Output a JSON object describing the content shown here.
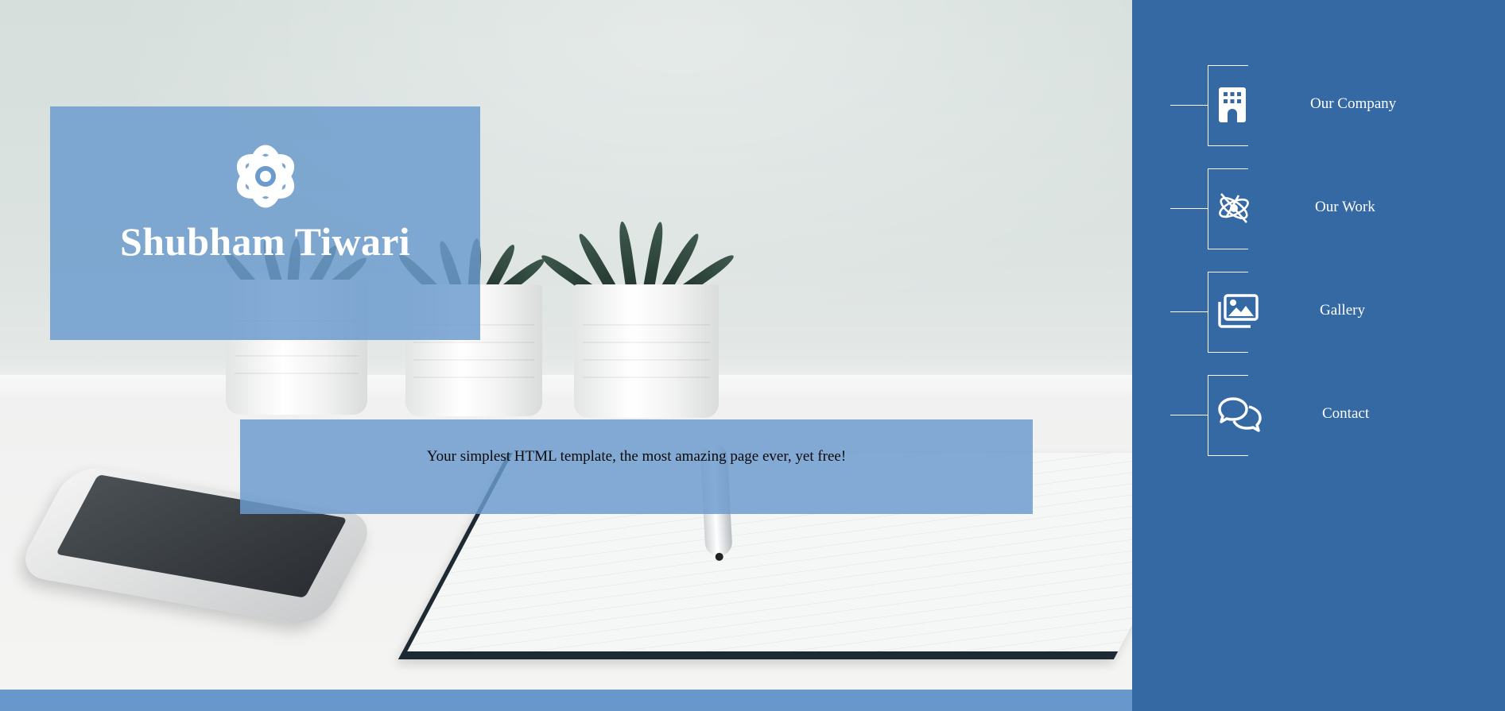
{
  "hero": {
    "title": "Shubham Tiwari",
    "logo_icon": "atom-icon",
    "tagline": "Your simplest HTML template, the most amazing page ever, yet free!"
  },
  "nav": {
    "items": [
      {
        "label": "Our Company",
        "icon": "building-icon"
      },
      {
        "label": "Our Work",
        "icon": "satellite-orbit-icon"
      },
      {
        "label": "Gallery",
        "icon": "images-icon"
      },
      {
        "label": "Contact",
        "icon": "chat-bubbles-icon"
      }
    ]
  },
  "colors": {
    "sidebar": "#3569a4",
    "card_overlay": "#6b9bcd",
    "bottom_strip": "#6898cb",
    "text_light": "#ffffff",
    "text_dark": "#0a0a0a"
  }
}
